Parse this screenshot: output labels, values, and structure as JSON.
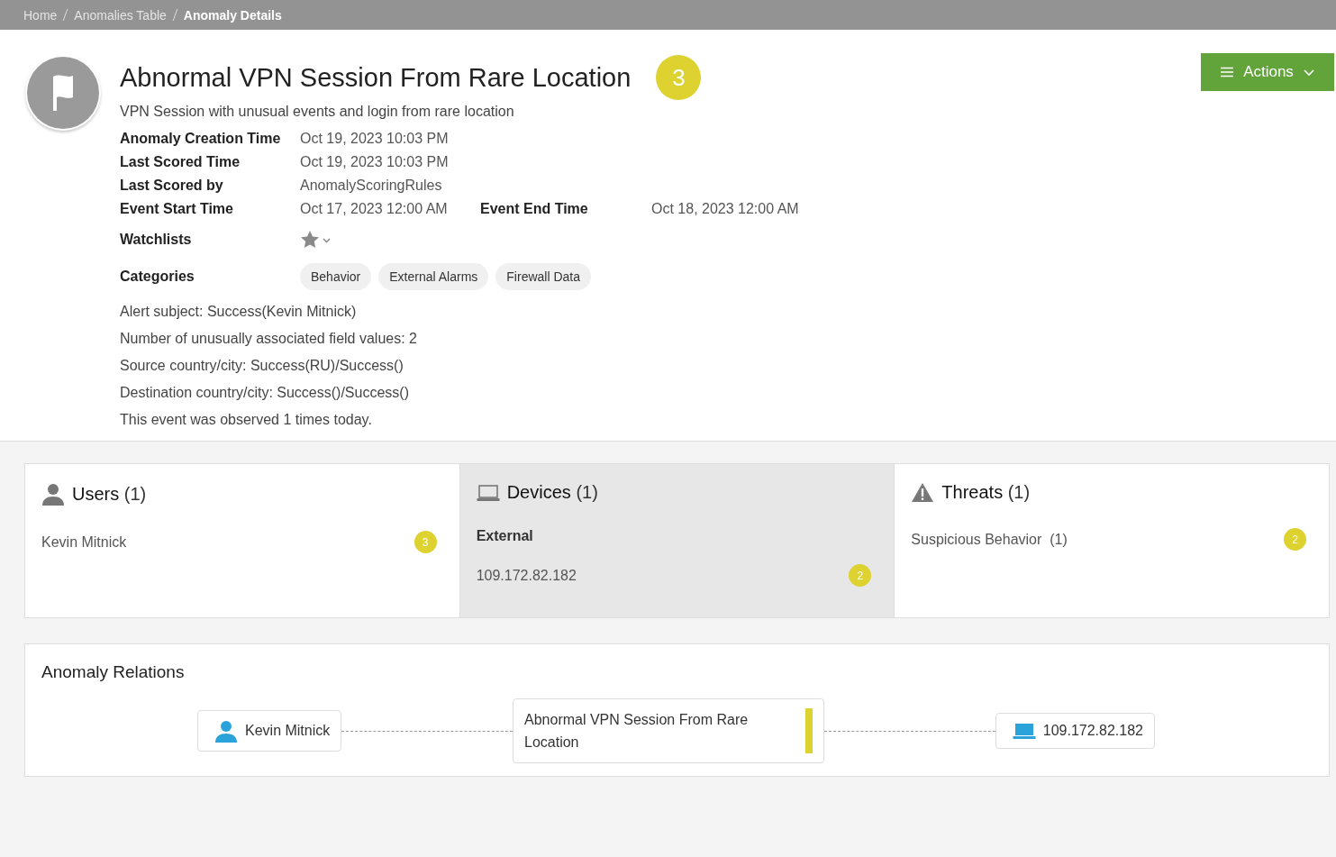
{
  "breadcrumb": [
    {
      "label": "Home",
      "current": false
    },
    {
      "label": "Anomalies Table",
      "current": false
    },
    {
      "label": "Anomaly Details",
      "current": true
    }
  ],
  "header": {
    "title": "Abnormal VPN Session From Rare Location",
    "score": "3",
    "subtitle": "VPN Session with unusual events and login from rare location",
    "actions_button": "Actions"
  },
  "details": [
    [
      {
        "label": "Anomaly Creation Time",
        "value": "Oct 19, 2023 10:03 PM"
      }
    ],
    [
      {
        "label": "Last Scored Time",
        "value": "Oct 19, 2023 10:03 PM"
      }
    ],
    [
      {
        "label": "Last Scored by",
        "value": "AnomalyScoringRules"
      }
    ],
    [
      {
        "label": "Event Start Time",
        "value": "Oct 17, 2023 12:00 AM"
      },
      {
        "label": "Event End Time",
        "value": "Oct 18, 2023 12:00 AM"
      }
    ]
  ],
  "watchlists": {
    "label": "Watchlists"
  },
  "categories": {
    "label": "Categories",
    "tags": [
      "Behavior",
      "External Alarms",
      "Firewall Data"
    ]
  },
  "notes": [
    "Alert subject: Success(Kevin Mitnick)",
    "Number of unusually associated field values: 2",
    "Source country/city: Success(RU)/Success()",
    "Destination country/city: Success()/Success()",
    "This event was observed 1 times today."
  ],
  "panels": [
    {
      "kind": "users",
      "title": "Users",
      "count": "(1)",
      "selected": false,
      "items": [
        {
          "kind": "entry",
          "label": "Kevin Mitnick",
          "score": "3"
        }
      ]
    },
    {
      "kind": "devices",
      "title": "Devices",
      "count": "(1)",
      "selected": true,
      "items": [
        {
          "kind": "group",
          "label": "External"
        },
        {
          "kind": "entry",
          "label": "109.172.82.182",
          "score": "2"
        }
      ]
    },
    {
      "kind": "threats",
      "title": "Threats",
      "count": "(1)",
      "selected": false,
      "items": [
        {
          "kind": "entry",
          "label": "Suspicious Behavior",
          "count": "(1)",
          "score": "2"
        }
      ]
    }
  ],
  "relations": {
    "title": "Anomaly Relations",
    "nodes": [
      {
        "kind": "user",
        "label": "Kevin Mitnick"
      },
      {
        "kind": "anomaly",
        "label": "Abnormal VPN Session From Rare Location"
      },
      {
        "kind": "device",
        "label": "109.172.82.182"
      }
    ]
  }
}
